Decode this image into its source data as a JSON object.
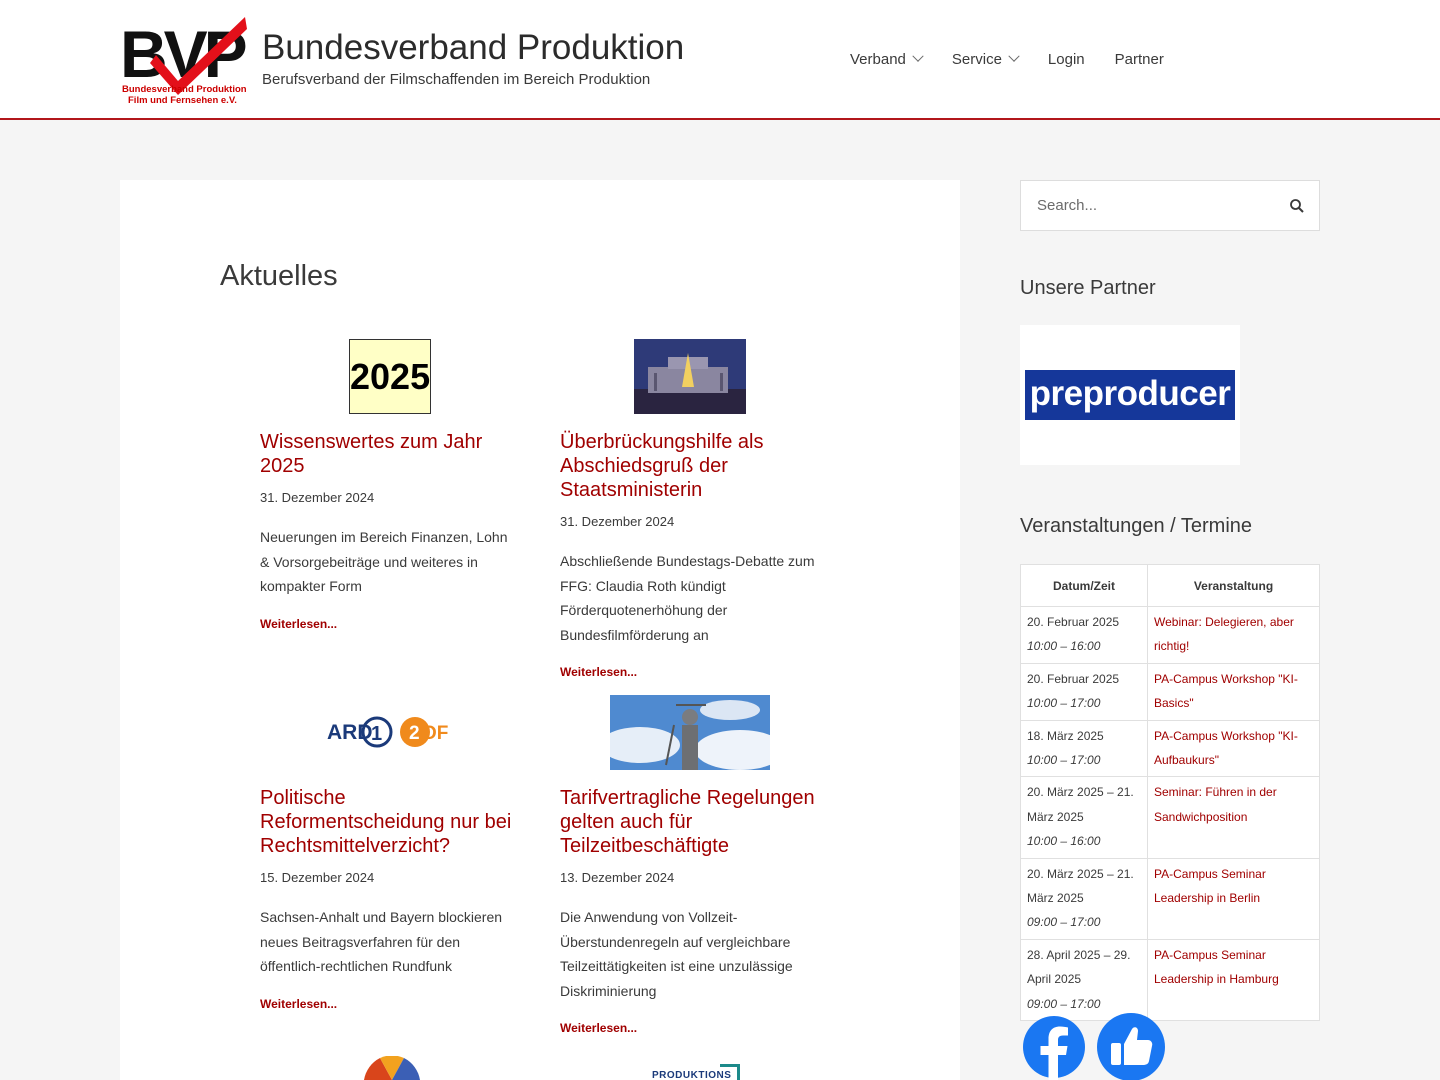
{
  "header": {
    "logo_text": "BVP",
    "logo_caption_1": "Bundesverband Produktion",
    "logo_caption_2": "Film und Fernsehen e.V.",
    "site_title": "Bundesverband Produktion",
    "tagline": "Berufsverband der Filmschaffenden im Bereich Produktion"
  },
  "nav": [
    {
      "label": "Verband",
      "dropdown": true
    },
    {
      "label": "Service",
      "dropdown": true
    },
    {
      "label": "Login",
      "dropdown": false
    },
    {
      "label": "Partner",
      "dropdown": false
    }
  ],
  "main": {
    "title": "Aktuelles",
    "read_more": "Weiterlesen...",
    "posts": [
      {
        "thumb": "2025",
        "title": "Wissenswertes zum Jahr 2025",
        "date": "31. Dezember 2024",
        "excerpt": "Neuerungen im Bereich Finanzen, Lohn & Vorsorgebeiträge und weiteres in kompakter Form"
      },
      {
        "thumb": "reichstag-night-image",
        "title": "Überbrückungshilfe als Abschiedsgruß der Staatsministerin",
        "date": "31. Dezember 2024",
        "excerpt": "Abschließende Bundestags-Debatte zum FFG: Claudia Roth kündigt Förderquotenerhöhung der Bundesfilmförderung an"
      },
      {
        "thumb": "ARD ZDF",
        "title": "Politische Reformentscheidung nur bei Rechtsmittelverzicht?",
        "date": "15. Dezember 2024",
        "excerpt": "Sachsen-Anhalt und Bayern blockieren neues Beitragsverfahren für den öffentlich-rechtlichen Rundfunk"
      },
      {
        "thumb": "justitia-statue-image",
        "title": "Tarifvertragliche Regelungen gelten auch für Teilzeitbeschäftigte",
        "date": "13. Dezember 2024",
        "excerpt": "Die Anwendung von Vollzeit-Überstundenregeln auf vergleichbare Teilzeittätigkeiten ist eine unzulässige Diskriminierung"
      }
    ],
    "partial_thumb_2": "PRODUKTIONS"
  },
  "sidebar": {
    "search_placeholder": "Search...",
    "partners_title": "Unsere Partner",
    "partner_logo": "preproducer",
    "events_title": "Veranstaltungen / Termine",
    "events_headers": [
      "Datum/Zeit",
      "Veranstaltung"
    ],
    "events": [
      {
        "date": "20. Februar 2025",
        "time": "10:00 – 16:00",
        "title": "Webinar: Delegieren, aber richtig!"
      },
      {
        "date": "20. Februar 2025",
        "time": "10:00 – 17:00",
        "title": "PA-Campus Workshop \"KI-Basics\""
      },
      {
        "date": "18. März 2025",
        "time": "10:00 – 17:00",
        "title": "PA-Campus Workshop \"KI-Aufbaukurs\""
      },
      {
        "date": "20. März 2025 – 21. März 2025",
        "time": "10:00 – 16:00",
        "title": "Seminar: Führen in der Sandwichposition"
      },
      {
        "date": "20. März 2025 – 21. März 2025",
        "time": "09:00 – 17:00",
        "title": "PA-Campus Seminar Leadership in Berlin"
      },
      {
        "date": "28. April 2025 – 29. April 2025",
        "time": "09:00 – 17:00",
        "title": "PA-Campus Seminar Leadership in Hamburg"
      }
    ],
    "social_icons": [
      "facebook-icon",
      "thumbs-up-icon"
    ]
  },
  "colors": {
    "accent": "#a00000",
    "header_border": "#b2161b",
    "facebook": "#1a77f2"
  }
}
